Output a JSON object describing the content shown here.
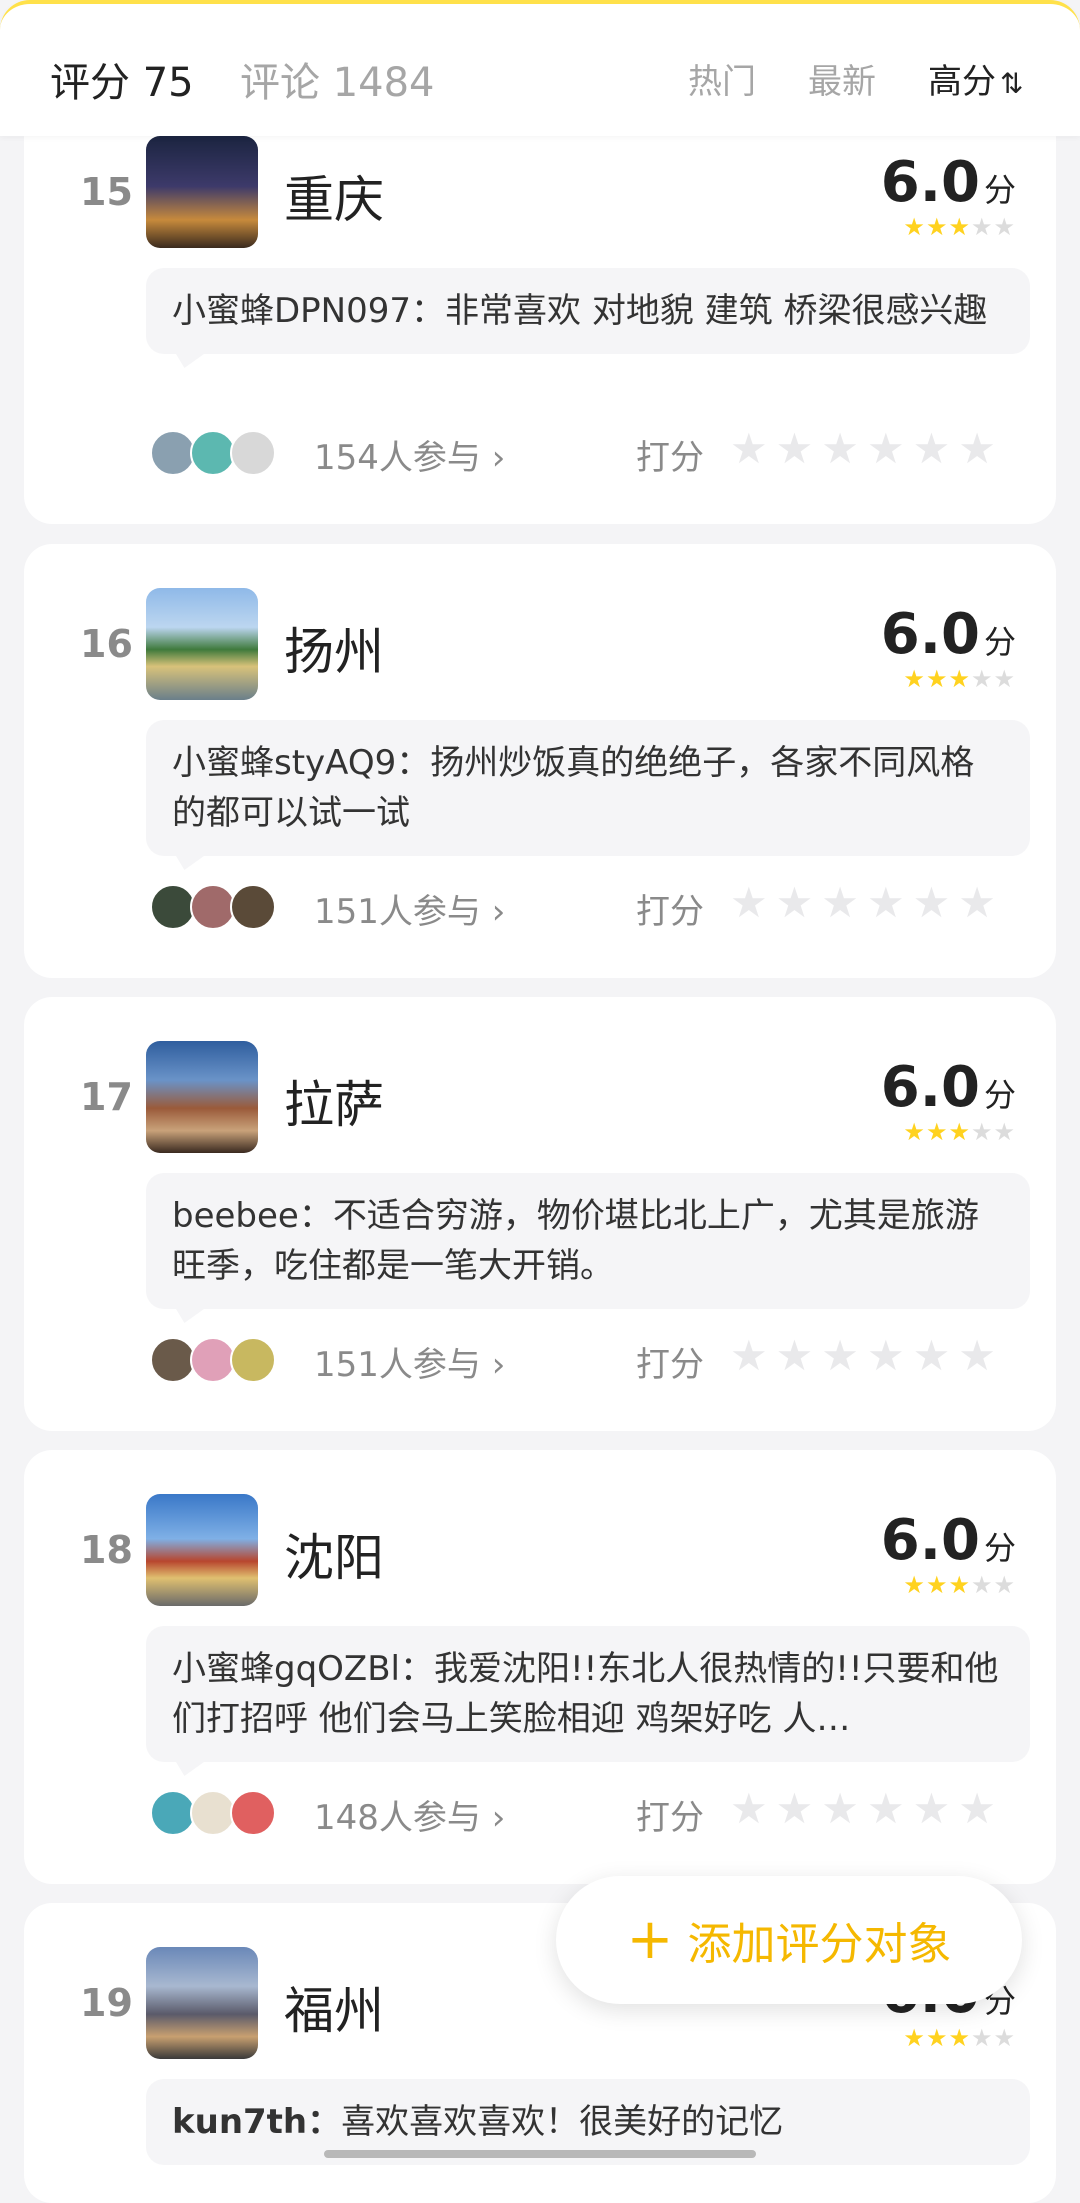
{
  "header": {
    "score_label": "评分 75",
    "comments_label": "评论 1484",
    "tabs": [
      {
        "label": "热门",
        "active": false
      },
      {
        "label": "最新",
        "active": false
      },
      {
        "label": "高分",
        "active": true
      }
    ],
    "sort_icon": "⇅"
  },
  "items": [
    {
      "rank": "15",
      "name": "重庆",
      "score": "6.0",
      "unit": "分",
      "stars_filled": 3,
      "stars_total": 5,
      "comment_user": "小蜜蜂DPN097：",
      "comment_text": "非常喜欢 对地貌 建筑 桥梁很感兴趣",
      "participants": "154人参与 ›",
      "rate_label": "打分"
    },
    {
      "rank": "16",
      "name": "扬州",
      "score": "6.0",
      "unit": "分",
      "stars_filled": 3,
      "stars_total": 5,
      "comment_user": "小蜜蜂styAQ9：",
      "comment_text": "扬州炒饭真的绝绝子，各家不同风格的都可以试一试",
      "participants": "151人参与 ›",
      "rate_label": "打分"
    },
    {
      "rank": "17",
      "name": "拉萨",
      "score": "6.0",
      "unit": "分",
      "stars_filled": 3,
      "stars_total": 5,
      "comment_user": "beebee：",
      "comment_text": "不适合穷游，物价堪比北上广，尤其是旅游旺季，吃住都是一笔大开销。",
      "participants": "151人参与 ›",
      "rate_label": "打分"
    },
    {
      "rank": "18",
      "name": "沈阳",
      "score": "6.0",
      "unit": "分",
      "stars_filled": 3,
      "stars_total": 5,
      "comment_user": "小蜜蜂gqOZBl：",
      "comment_text": "我爱沈阳!!东北人很热情的!!只要和他们打招呼 他们会马上笑脸相迎 鸡架好吃 人…",
      "participants": "148人参与 ›",
      "rate_label": "打分"
    },
    {
      "rank": "19",
      "name": "福州",
      "score": "6.0",
      "unit": "分",
      "stars_filled": 3,
      "stars_total": 5,
      "comment_user": "kun7th：",
      "comment_text": "喜欢喜欢喜欢！很美好的记忆",
      "participants": "",
      "rate_label": ""
    }
  ],
  "fab": {
    "plus": "+",
    "label": "添加评分对象"
  },
  "colors": {
    "accent": "#f5b800",
    "star_on": "#ffd21f",
    "star_off": "#dcdcdc",
    "card_bg": "#ffffff",
    "page_bg": "#f4f4f6"
  }
}
